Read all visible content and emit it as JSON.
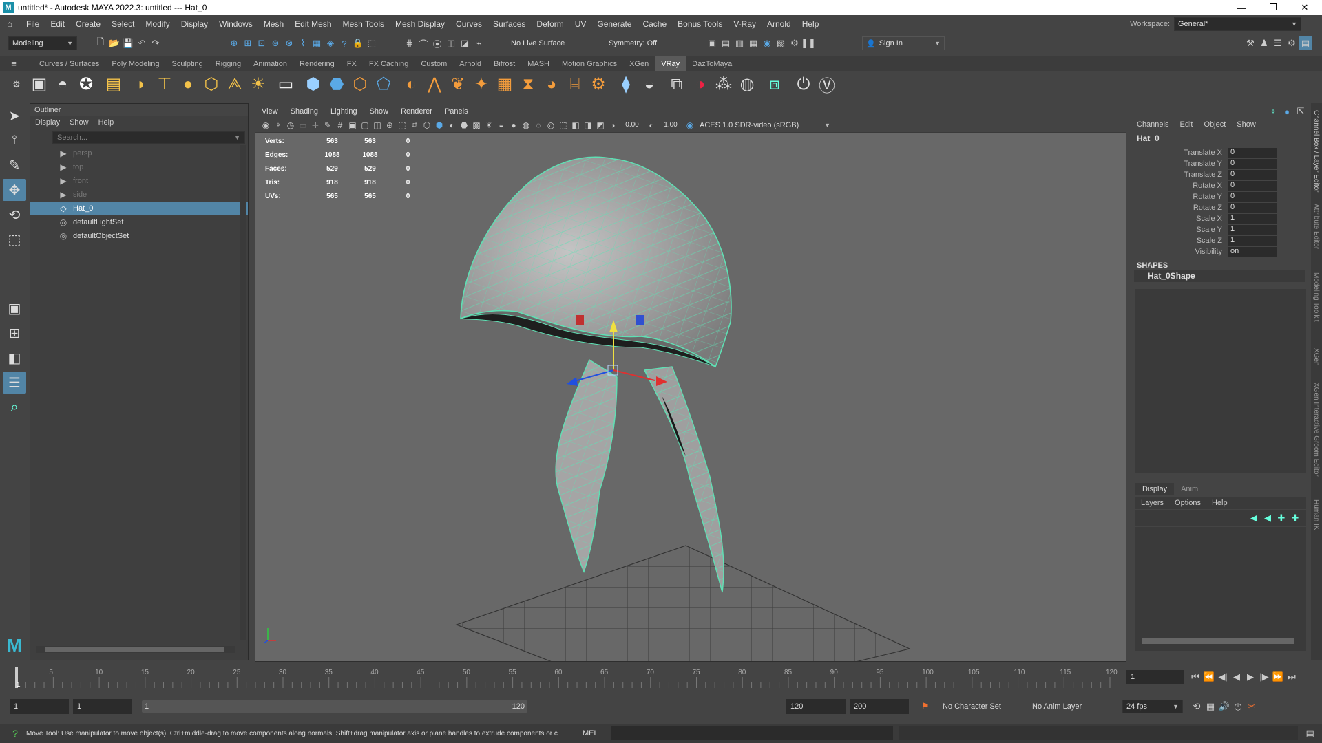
{
  "title_bar": {
    "text": "untitled* - Autodesk MAYA 2022.3: untitled  ---  Hat_0"
  },
  "menu": [
    "File",
    "Edit",
    "Create",
    "Select",
    "Modify",
    "Display",
    "Windows",
    "Mesh",
    "Edit Mesh",
    "Mesh Tools",
    "Mesh Display",
    "Curves",
    "Surfaces",
    "Deform",
    "UV",
    "Generate",
    "Cache",
    "Bonus Tools",
    "V-Ray",
    "Arnold",
    "Help"
  ],
  "workspace": {
    "label": "Workspace:",
    "value": "General*"
  },
  "status": {
    "mode": "Modeling",
    "live_surface": "No Live Surface",
    "symmetry": "Symmetry: Off",
    "sign_in": "Sign In"
  },
  "shelf_tabs": [
    "Curves / Surfaces",
    "Poly Modeling",
    "Sculpting",
    "Rigging",
    "Animation",
    "Rendering",
    "FX",
    "FX Caching",
    "Custom",
    "Arnold",
    "Bifrost",
    "MASH",
    "Motion Graphics",
    "XGen",
    "VRay",
    "DazToMaya"
  ],
  "active_shelf": "VRay",
  "outliner": {
    "title": "Outliner",
    "menu": [
      "Display",
      "Show",
      "Help"
    ],
    "search_placeholder": "Search...",
    "items": [
      {
        "label": "persp"
      },
      {
        "label": "top"
      },
      {
        "label": "front"
      },
      {
        "label": "side"
      },
      {
        "label": "Hat_0"
      },
      {
        "label": "defaultLightSet"
      },
      {
        "label": "defaultObjectSet"
      }
    ]
  },
  "viewport": {
    "menu": [
      "View",
      "Shading",
      "Lighting",
      "Show",
      "Renderer",
      "Panels"
    ],
    "exposure": "0.00",
    "gamma": "1.00",
    "color_space": "ACES 1.0 SDR-video (sRGB)",
    "hud": [
      {
        "label": "Verts:",
        "a": "563",
        "b": "563",
        "c": "0"
      },
      {
        "label": "Edges:",
        "a": "1088",
        "b": "1088",
        "c": "0"
      },
      {
        "label": "Faces:",
        "a": "529",
        "b": "529",
        "c": "0"
      },
      {
        "label": "Tris:",
        "a": "918",
        "b": "918",
        "c": "0"
      },
      {
        "label": "UVs:",
        "a": "565",
        "b": "565",
        "c": "0"
      }
    ],
    "colors": {
      "wire": "#5fe0b4",
      "mesh": "#a9a9a9"
    }
  },
  "channel_box": {
    "menu": [
      "Channels",
      "Edit",
      "Object",
      "Show"
    ],
    "object": "Hat_0",
    "attrs": [
      {
        "name": "Translate X",
        "value": "0"
      },
      {
        "name": "Translate Y",
        "value": "0"
      },
      {
        "name": "Translate Z",
        "value": "0"
      },
      {
        "name": "Rotate X",
        "value": "0"
      },
      {
        "name": "Rotate Y",
        "value": "0"
      },
      {
        "name": "Rotate Z",
        "value": "0"
      },
      {
        "name": "Scale X",
        "value": "1"
      },
      {
        "name": "Scale Y",
        "value": "1"
      },
      {
        "name": "Scale Z",
        "value": "1"
      },
      {
        "name": "Visibility",
        "value": "on"
      }
    ],
    "shapes_label": "SHAPES",
    "shape": "Hat_0Shape",
    "layer_tabs": [
      "Display",
      "Anim"
    ],
    "layer_menu": [
      "Layers",
      "Options",
      "Help"
    ]
  },
  "side_tabs": [
    "Channel Box / Layer Editor",
    "Attribute Editor",
    "Modeling Toolkit",
    "XGen",
    "XGen Interactive Groom Editor",
    "Human IK"
  ],
  "timeline": {
    "ticks": [
      "5",
      "10",
      "15",
      "20",
      "25",
      "30",
      "35",
      "40",
      "45",
      "50",
      "55",
      "60",
      "65",
      "70",
      "75",
      "80",
      "85",
      "90",
      "95",
      "100",
      "105",
      "110",
      "115",
      "120"
    ],
    "current": "1",
    "current_field": "1"
  },
  "range": {
    "start": "1",
    "start2": "1",
    "slider_start": "1",
    "slider_end": "120",
    "end": "120",
    "end2": "200",
    "character_set": "No Character Set",
    "anim_layer": "No Anim Layer",
    "fps": "24 fps"
  },
  "help_line": {
    "text": "Move Tool: Use manipulator to move object(s). Ctrl+middle-drag to move components along normals. Shift+drag manipulator axis or plane handles to extrude components or c",
    "mel": "MEL"
  }
}
